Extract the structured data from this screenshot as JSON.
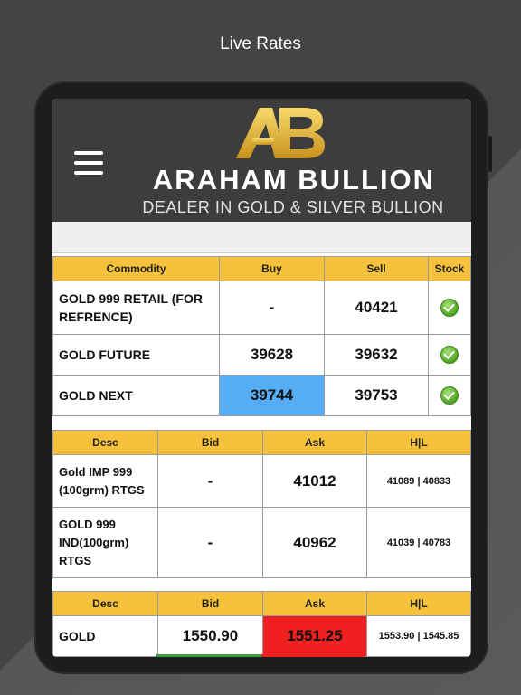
{
  "caption": "Live Rates",
  "brand": {
    "logo_text": "AB",
    "name": "ARAHAM BULLION",
    "tagline": "DEALER IN GOLD & SILVER BULLION"
  },
  "icons": {
    "menu": "hamburger-menu-icon",
    "stock": "green-check-icon"
  },
  "colors": {
    "header_bg": "#f6c23c",
    "highlight_blue": "#55adf5",
    "highlight_red": "#f02020",
    "stock_ok": "#4ea420"
  },
  "table1": {
    "headers": [
      "Commodity",
      "Buy",
      "Sell",
      "Stock"
    ],
    "rows": [
      {
        "name": "GOLD 999 RETAIL (FOR REFRENCE)",
        "buy": "-",
        "sell": "40421"
      },
      {
        "name": "GOLD FUTURE",
        "buy": "39628",
        "sell": "39632"
      },
      {
        "name": "GOLD NEXT",
        "buy": "39744",
        "sell": "39753"
      }
    ]
  },
  "table2": {
    "headers": [
      "Desc",
      "Bid",
      "Ask",
      "H|L"
    ],
    "rows": [
      {
        "desc": "Gold IMP 999 (100grm) RTGS",
        "bid": "-",
        "ask": "41012",
        "hl": "41089 | 40833"
      },
      {
        "desc": "GOLD 999 IND(100grm) RTGS",
        "bid": "-",
        "ask": "40962",
        "hl": "41039 | 40783"
      }
    ]
  },
  "table3": {
    "headers": [
      "Desc",
      "Bid",
      "Ask",
      "H|L"
    ],
    "rows": [
      {
        "desc": "GOLD",
        "bid": "1550.90",
        "ask": "1551.25",
        "hl": "1553.90 | 1545.85"
      }
    ]
  }
}
